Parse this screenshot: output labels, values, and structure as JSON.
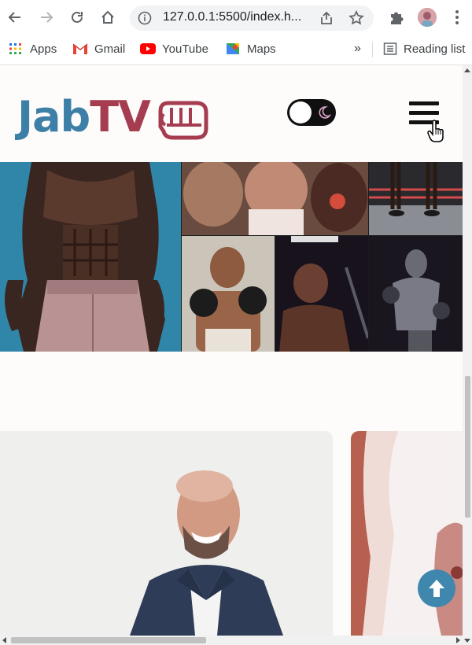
{
  "browser": {
    "url": "127.0.0.1:5500/index.h...",
    "bookmarks": [
      {
        "label": "Apps",
        "icon": "apps-grid-icon"
      },
      {
        "label": "Gmail",
        "icon": "gmail-icon"
      },
      {
        "label": "YouTube",
        "icon": "youtube-icon"
      },
      {
        "label": "Maps",
        "icon": "maps-icon"
      }
    ],
    "overflow_label": "»",
    "reading_list_label": "Reading list"
  },
  "site": {
    "logo_part1": "Jab",
    "logo_part2": "TV",
    "logo_icon": "boxing-glove-icon",
    "theme_toggle_icon": "moon-icon",
    "menu_icon": "hamburger-menu-icon",
    "scroll_top_icon": "arrow-up-icon"
  },
  "colors": {
    "brand_blue": "#3d7fa6",
    "brand_red": "#a53c50",
    "toggle_bg": "#101010",
    "scroll_top_bg": "#3f87ad"
  }
}
